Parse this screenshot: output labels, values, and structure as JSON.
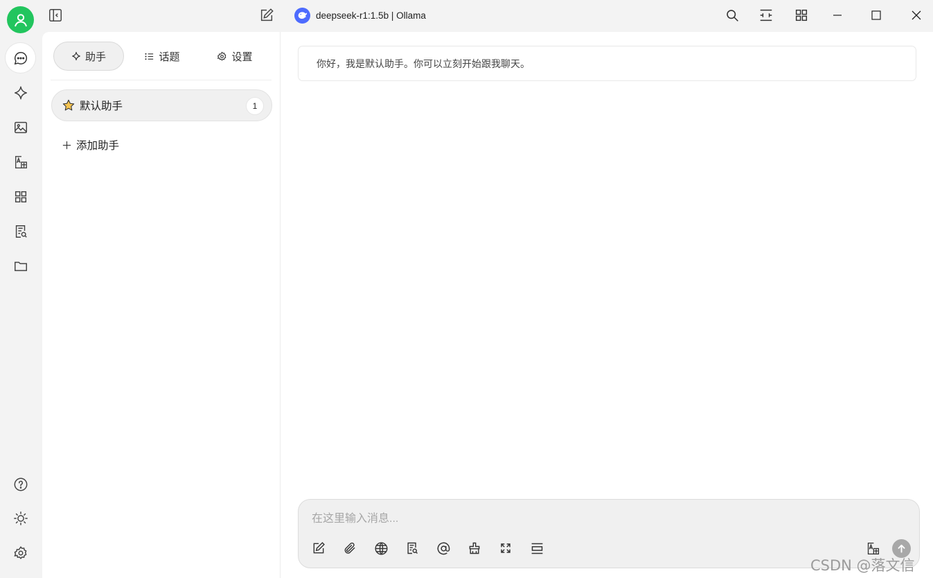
{
  "window": {
    "title": "deepseek-r1:1.5b | Ollama",
    "model_logo": "deepseek-whale-icon",
    "brand_color": "#4d6bfe",
    "avatar_color": "#22c55e"
  },
  "rail": {
    "top_items": [
      "chat-icon",
      "sparkle-icon",
      "image-icon",
      "translate-icon",
      "apps-icon",
      "knowledge-search-icon",
      "folder-icon"
    ],
    "bottom_items": [
      "help-icon",
      "theme-sun-icon",
      "settings-gear-icon"
    ],
    "active_item": "chat-icon"
  },
  "tabs": [
    {
      "label": "助手",
      "icon": "sparkle-icon",
      "active": true
    },
    {
      "label": "话题",
      "icon": "list-icon",
      "active": false
    },
    {
      "label": "设置",
      "icon": "gear-icon",
      "active": false
    }
  ],
  "assistants": [
    {
      "name": "默认助手",
      "icon": "star-icon",
      "count": "1"
    }
  ],
  "add_assistant_label": "添加助手",
  "chat": {
    "greeting": "你好，我是默认助手。你可以立刻开始跟我聊天。",
    "input_placeholder": "在这里输入消息...",
    "input_value": "",
    "tools": [
      "new-topic-icon",
      "attachment-icon",
      "web-search-icon",
      "knowledge-base-icon",
      "mention-icon",
      "clear-icon",
      "expand-icon",
      "new-context-icon",
      "translate-icon",
      "send-icon"
    ]
  },
  "watermark": "CSDN @落文信"
}
